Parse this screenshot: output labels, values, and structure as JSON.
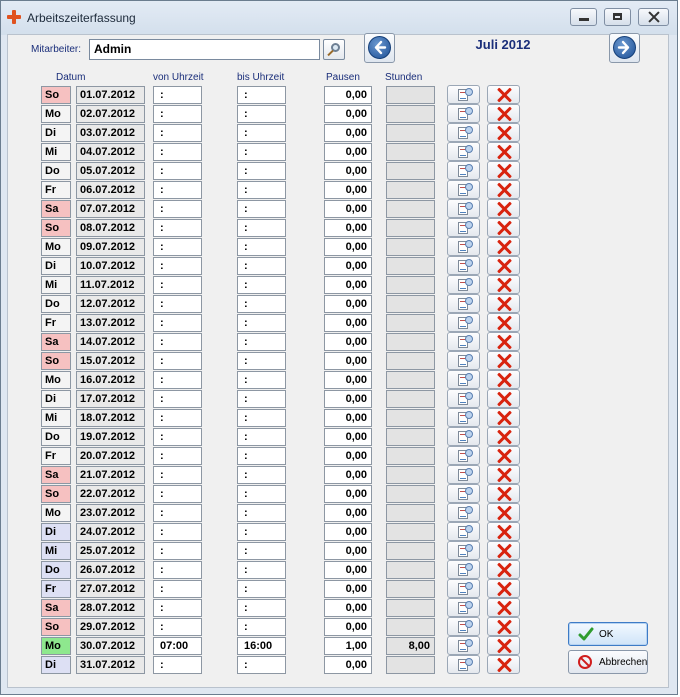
{
  "window": {
    "title": "Arbeitszeiterfassung"
  },
  "header": {
    "employee_label": "Mitarbeiter:",
    "employee_value": "Admin",
    "month": "Juli 2012"
  },
  "columns": {
    "date": "Datum",
    "from": "von Uhrzeit",
    "to": "bis Uhrzeit",
    "breaks": "Pausen",
    "hours": "Stunden"
  },
  "rows": [
    {
      "day": "So",
      "date": "01.07.2012",
      "from": ":",
      "to": ":",
      "breaks": "0,00",
      "hours": "",
      "kind": "we"
    },
    {
      "day": "Mo",
      "date": "02.07.2012",
      "from": ":",
      "to": ":",
      "breaks": "0,00",
      "hours": "",
      "kind": "wk"
    },
    {
      "day": "Di",
      "date": "03.07.2012",
      "from": ":",
      "to": ":",
      "breaks": "0,00",
      "hours": "",
      "kind": "wk"
    },
    {
      "day": "Mi",
      "date": "04.07.2012",
      "from": ":",
      "to": ":",
      "breaks": "0,00",
      "hours": "",
      "kind": "wk"
    },
    {
      "day": "Do",
      "date": "05.07.2012",
      "from": ":",
      "to": ":",
      "breaks": "0,00",
      "hours": "",
      "kind": "wk"
    },
    {
      "day": "Fr",
      "date": "06.07.2012",
      "from": ":",
      "to": ":",
      "breaks": "0,00",
      "hours": "",
      "kind": "wk"
    },
    {
      "day": "Sa",
      "date": "07.07.2012",
      "from": ":",
      "to": ":",
      "breaks": "0,00",
      "hours": "",
      "kind": "we"
    },
    {
      "day": "So",
      "date": "08.07.2012",
      "from": ":",
      "to": ":",
      "breaks": "0,00",
      "hours": "",
      "kind": "we"
    },
    {
      "day": "Mo",
      "date": "09.07.2012",
      "from": ":",
      "to": ":",
      "breaks": "0,00",
      "hours": "",
      "kind": "wk"
    },
    {
      "day": "Di",
      "date": "10.07.2012",
      "from": ":",
      "to": ":",
      "breaks": "0,00",
      "hours": "",
      "kind": "wk"
    },
    {
      "day": "Mi",
      "date": "11.07.2012",
      "from": ":",
      "to": ":",
      "breaks": "0,00",
      "hours": "",
      "kind": "wk"
    },
    {
      "day": "Do",
      "date": "12.07.2012",
      "from": ":",
      "to": ":",
      "breaks": "0,00",
      "hours": "",
      "kind": "wk"
    },
    {
      "day": "Fr",
      "date": "13.07.2012",
      "from": ":",
      "to": ":",
      "breaks": "0,00",
      "hours": "",
      "kind": "wk"
    },
    {
      "day": "Sa",
      "date": "14.07.2012",
      "from": ":",
      "to": ":",
      "breaks": "0,00",
      "hours": "",
      "kind": "we"
    },
    {
      "day": "So",
      "date": "15.07.2012",
      "from": ":",
      "to": ":",
      "breaks": "0,00",
      "hours": "",
      "kind": "we"
    },
    {
      "day": "Mo",
      "date": "16.07.2012",
      "from": ":",
      "to": ":",
      "breaks": "0,00",
      "hours": "",
      "kind": "wk"
    },
    {
      "day": "Di",
      "date": "17.07.2012",
      "from": ":",
      "to": ":",
      "breaks": "0,00",
      "hours": "",
      "kind": "wk"
    },
    {
      "day": "Mi",
      "date": "18.07.2012",
      "from": ":",
      "to": ":",
      "breaks": "0,00",
      "hours": "",
      "kind": "wk"
    },
    {
      "day": "Do",
      "date": "19.07.2012",
      "from": ":",
      "to": ":",
      "breaks": "0,00",
      "hours": "",
      "kind": "wk"
    },
    {
      "day": "Fr",
      "date": "20.07.2012",
      "from": ":",
      "to": ":",
      "breaks": "0,00",
      "hours": "",
      "kind": "wk"
    },
    {
      "day": "Sa",
      "date": "21.07.2012",
      "from": ":",
      "to": ":",
      "breaks": "0,00",
      "hours": "",
      "kind": "we"
    },
    {
      "day": "So",
      "date": "22.07.2012",
      "from": ":",
      "to": ":",
      "breaks": "0,00",
      "hours": "",
      "kind": "we"
    },
    {
      "day": "Mo",
      "date": "23.07.2012",
      "from": ":",
      "to": ":",
      "breaks": "0,00",
      "hours": "",
      "kind": "wk"
    },
    {
      "day": "Di",
      "date": "24.07.2012",
      "from": ":",
      "to": ":",
      "breaks": "0,00",
      "hours": "",
      "kind": "hl"
    },
    {
      "day": "Mi",
      "date": "25.07.2012",
      "from": ":",
      "to": ":",
      "breaks": "0,00",
      "hours": "",
      "kind": "hl"
    },
    {
      "day": "Do",
      "date": "26.07.2012",
      "from": ":",
      "to": ":",
      "breaks": "0,00",
      "hours": "",
      "kind": "hl"
    },
    {
      "day": "Fr",
      "date": "27.07.2012",
      "from": ":",
      "to": ":",
      "breaks": "0,00",
      "hours": "",
      "kind": "hl"
    },
    {
      "day": "Sa",
      "date": "28.07.2012",
      "from": ":",
      "to": ":",
      "breaks": "0,00",
      "hours": "",
      "kind": "we"
    },
    {
      "day": "So",
      "date": "29.07.2012",
      "from": ":",
      "to": ":",
      "breaks": "0,00",
      "hours": "",
      "kind": "we"
    },
    {
      "day": "Mo",
      "date": "30.07.2012",
      "from": "07:00",
      "to": "16:00",
      "breaks": "1,00",
      "hours": "8,00",
      "kind": "today"
    },
    {
      "day": "Di",
      "date": "31.07.2012",
      "from": ":",
      "to": ":",
      "breaks": "0,00",
      "hours": "",
      "kind": "hl"
    }
  ],
  "buttons": {
    "ok": "OK",
    "cancel": "Abbrechen"
  },
  "colors": {
    "weekend": "#f6c1c1",
    "weekday": "#f4f4f4",
    "highlight": "#dde0f4",
    "today": "#8ee88e",
    "accent": "#1a2e7a",
    "delete": "#d8230e"
  }
}
